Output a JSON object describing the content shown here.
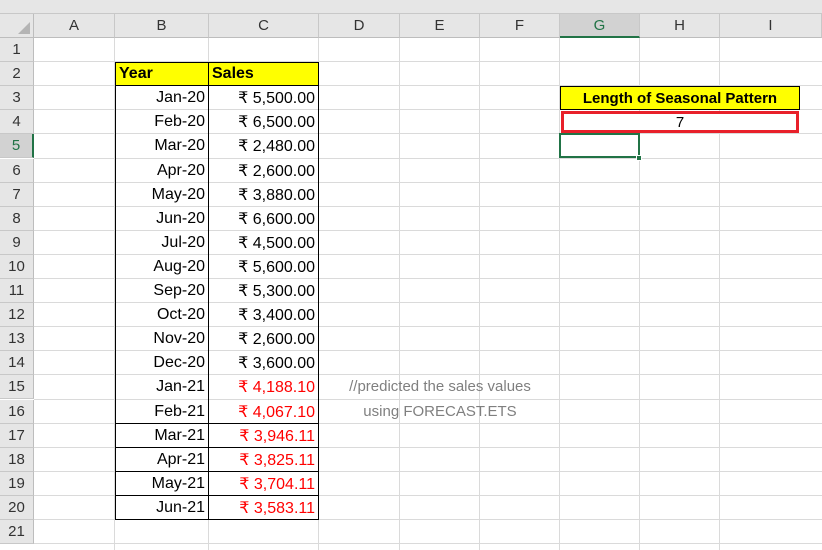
{
  "columns": [
    "A",
    "B",
    "C",
    "D",
    "E",
    "F",
    "G",
    "H",
    "I"
  ],
  "rows": [
    "1",
    "2",
    "3",
    "4",
    "5",
    "6",
    "7",
    "8",
    "9",
    "10",
    "11",
    "12",
    "13",
    "14",
    "15",
    "16",
    "17",
    "18",
    "19",
    "20",
    "21"
  ],
  "table": {
    "header_year": "Year",
    "header_sales": "Sales",
    "data": [
      {
        "year": "Jan-20",
        "sales": "₹ 5,500.00",
        "predicted": false
      },
      {
        "year": "Feb-20",
        "sales": "₹ 6,500.00",
        "predicted": false
      },
      {
        "year": "Mar-20",
        "sales": "₹ 2,480.00",
        "predicted": false
      },
      {
        "year": "Apr-20",
        "sales": "₹ 2,600.00",
        "predicted": false
      },
      {
        "year": "May-20",
        "sales": "₹ 3,880.00",
        "predicted": false
      },
      {
        "year": "Jun-20",
        "sales": "₹ 6,600.00",
        "predicted": false
      },
      {
        "year": "Jul-20",
        "sales": "₹ 4,500.00",
        "predicted": false
      },
      {
        "year": "Aug-20",
        "sales": "₹ 5,600.00",
        "predicted": false
      },
      {
        "year": "Sep-20",
        "sales": "₹ 5,300.00",
        "predicted": false
      },
      {
        "year": "Oct-20",
        "sales": "₹ 3,400.00",
        "predicted": false
      },
      {
        "year": "Nov-20",
        "sales": "₹ 2,600.00",
        "predicted": false
      },
      {
        "year": "Dec-20",
        "sales": "₹ 3,600.00",
        "predicted": false
      },
      {
        "year": "Jan-21",
        "sales": "₹ 4,188.10",
        "predicted": true
      },
      {
        "year": "Feb-21",
        "sales": "₹ 4,067.10",
        "predicted": true
      },
      {
        "year": "Mar-21",
        "sales": "₹ 3,946.11",
        "predicted": true
      },
      {
        "year": "Apr-21",
        "sales": "₹ 3,825.11",
        "predicted": true
      },
      {
        "year": "May-21",
        "sales": "₹ 3,704.11",
        "predicted": true
      },
      {
        "year": "Jun-21",
        "sales": "₹ 3,583.11",
        "predicted": true
      }
    ]
  },
  "seasonal": {
    "label": "Length of Seasonal Pattern",
    "value": "7"
  },
  "note": {
    "line1": "//predicted the sales values",
    "line2": "using FORECAST.ETS"
  },
  "selection": {
    "cell": "G5"
  },
  "colors": {
    "header_fill": "#ffff00",
    "predicted_text": "#ff0000",
    "highlight_box": "#e8202a",
    "selection_green": "#217346"
  }
}
